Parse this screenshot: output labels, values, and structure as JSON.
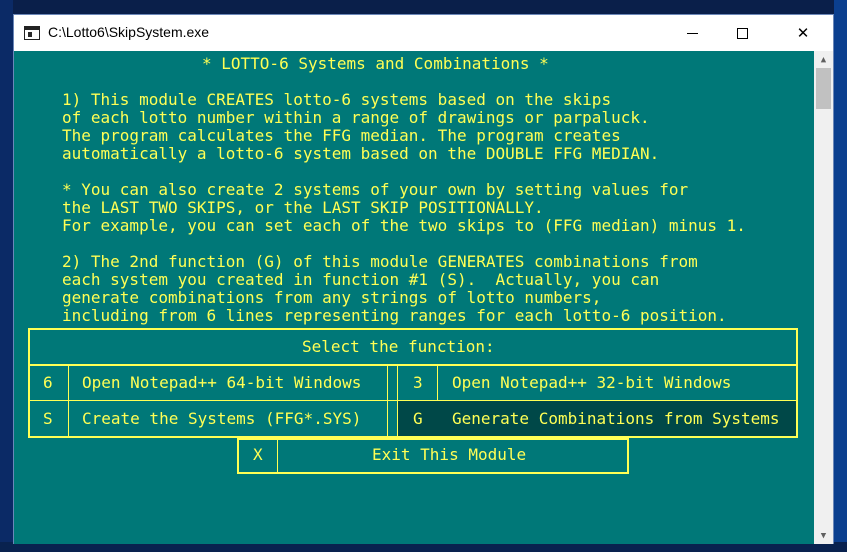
{
  "window": {
    "title": "C:\\Lotto6\\SkipSystem.exe",
    "controls": {
      "minimize": "—",
      "maximize": "☐",
      "close": "✕"
    }
  },
  "console": {
    "header": "* LOTTO-6 Systems and Combinations *",
    "paragraphs": [
      "1) This module CREATES lotto-6 systems based on the skips",
      "of each lotto number within a range of drawings or parpaluck.",
      "The program calculates the FFG median. The program creates",
      "automatically a lotto-6 system based on the DOUBLE FFG MEDIAN.",
      "* You can also create 2 systems of your own by setting values for",
      "the LAST TWO SKIPS, or the LAST SKIP POSITIONALLY.",
      "For example, you can set each of the two skips to (FFG median) minus 1.",
      "2) The 2nd function (G) of this module GENERATES combinations from",
      "each system you created in function #1 (S).  Actually, you can",
      "generate combinations from any strings of lotto numbers,",
      "including from 6 lines representing ranges for each lotto-6 position."
    ],
    "menu": {
      "title": "Select the function:",
      "options": [
        {
          "key": "6",
          "label": "Open Notepad++ 64-bit Windows"
        },
        {
          "key": "3",
          "label": "Open Notepad++ 32-bit Windows"
        },
        {
          "key": "S",
          "label": "Create the Systems (FFG*.SYS)"
        },
        {
          "key": "G",
          "label": "Generate Combinations from Systems"
        }
      ],
      "exit": {
        "key": "X",
        "label": "Exit This Module"
      }
    }
  },
  "colors": {
    "console_bg": "#007878",
    "console_text": "#ffff55",
    "highlight_bg": "#004848"
  }
}
